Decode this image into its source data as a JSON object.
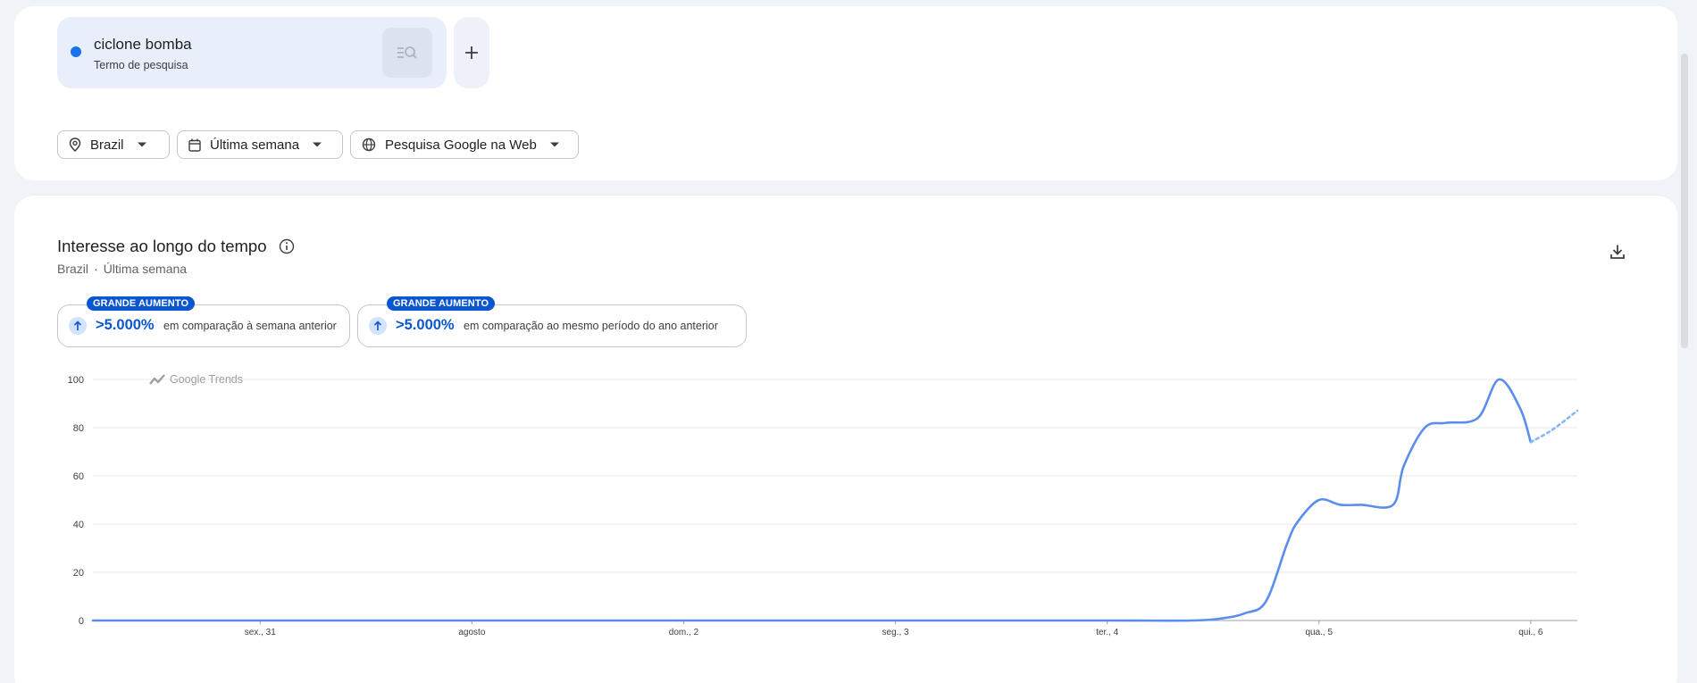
{
  "search_term": {
    "name": "ciclone bomba",
    "type_label": "Termo de pesquisa"
  },
  "filters": {
    "region": "Brazil",
    "period": "Última semana",
    "property": "Pesquisa Google na Web"
  },
  "section": {
    "title": "Interesse ao longo do tempo",
    "sub_region": "Brazil",
    "sub_separator": "·",
    "sub_period": "Última semana"
  },
  "stats": [
    {
      "badge": "GRANDE AUMENTO",
      "value": ">5.000%",
      "text": "em comparação à semana anterior"
    },
    {
      "badge": "GRANDE AUMENTO",
      "value": ">5.000%",
      "text": "em comparação ao mesmo período do ano anterior"
    }
  ],
  "watermark": "Google Trends",
  "colors": {
    "series": "#5b8def",
    "partial": "#8ab4f8",
    "accent": "#0b57d0",
    "term_dot": "#1a73e8"
  },
  "icons": [
    "magnifier-list-icon",
    "plus-icon",
    "location-pin-icon",
    "calendar-icon",
    "globe-icon",
    "caret-down-icon",
    "info-icon",
    "download-icon",
    "arrow-up-icon"
  ],
  "chart_data": {
    "type": "line",
    "title": "",
    "xlabel": "",
    "ylabel": "",
    "ylim": [
      0,
      100
    ],
    "y_ticks": [
      "100",
      "80",
      "60",
      "40",
      "20",
      "0"
    ],
    "y_tick_values": [
      100,
      80,
      60,
      40,
      20,
      0
    ],
    "x_ticks": [
      "sex., 31",
      "agosto",
      "dom., 2",
      "seg., 3",
      "ter., 4",
      "qua., 5",
      "qui., 6"
    ],
    "x_tick_positions": [
      1,
      2,
      3,
      4,
      5,
      6,
      7
    ],
    "x_range": [
      0.21,
      7.22
    ],
    "grid": true,
    "legend": "none",
    "series": [
      {
        "values_x": [
          0.21,
          1,
          2,
          3,
          4,
          5,
          5.4,
          5.55,
          5.65,
          5.75,
          5.85,
          5.9,
          6.0,
          6.1,
          6.2,
          6.35,
          6.4,
          6.5,
          6.6,
          6.75,
          6.85,
          6.95,
          7.0
        ],
        "values_y": [
          0,
          0,
          0,
          0,
          0,
          0,
          0,
          1,
          3,
          8,
          32,
          41,
          50,
          48,
          48,
          48,
          64,
          80,
          82,
          84,
          100,
          88,
          74
        ]
      }
    ],
    "partial_series": {
      "values_x": [
        7.0,
        7.1,
        7.22
      ],
      "values_y": [
        74,
        79,
        87
      ]
    }
  }
}
